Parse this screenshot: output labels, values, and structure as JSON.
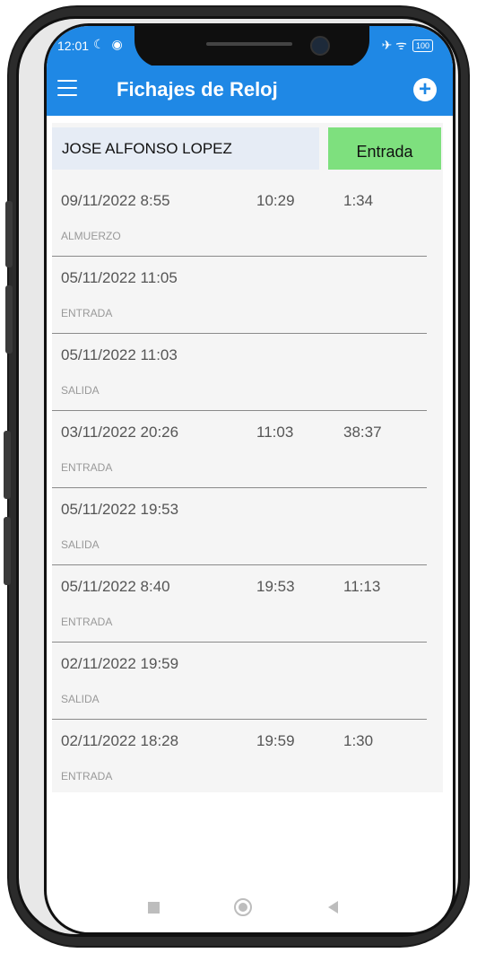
{
  "status": {
    "time": "12:01",
    "left_icons": "☾ ◉",
    "right_icons": "✈ ᯤ",
    "battery": "100"
  },
  "app": {
    "title": "Fichajes de Reloj",
    "menu_icon": "hamburger-menu-icon",
    "add_icon": "plus-circle-icon"
  },
  "header": {
    "employee_name": "JOSE ALFONSO LOPEZ",
    "entry_button_label": "Entrada",
    "entry_button_color": "#7ee07e"
  },
  "records": [
    {
      "datetime": "09/11/2022 8:55",
      "end": "10:29",
      "duration": "1:34",
      "type": "ALMUERZO"
    },
    {
      "datetime": "05/11/2022 11:05",
      "end": "",
      "duration": "",
      "type": "ENTRADA"
    },
    {
      "datetime": "05/11/2022 11:03",
      "end": "",
      "duration": "",
      "type": "SALIDA"
    },
    {
      "datetime": "03/11/2022 20:26",
      "end": "11:03",
      "duration": "38:37",
      "type": "ENTRADA"
    },
    {
      "datetime": "05/11/2022 19:53",
      "end": "",
      "duration": "",
      "type": "SALIDA"
    },
    {
      "datetime": "05/11/2022 8:40",
      "end": "19:53",
      "duration": "11:13",
      "type": "ENTRADA"
    },
    {
      "datetime": "02/11/2022 19:59",
      "end": "",
      "duration": "",
      "type": "SALIDA"
    },
    {
      "datetime": "02/11/2022 18:28",
      "end": "19:59",
      "duration": "1:30",
      "type": "ENTRADA"
    }
  ],
  "colors": {
    "app_bar": "#1f88e5",
    "name_field_bg": "#e6ecf5"
  }
}
